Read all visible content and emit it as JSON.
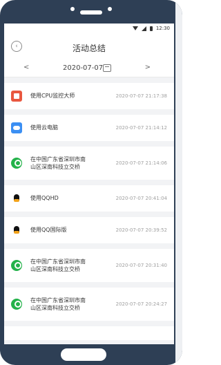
{
  "status": {
    "time": "12:30"
  },
  "header": {
    "title": "活动总结",
    "back_icon": "back-icon"
  },
  "date_nav": {
    "prev": "<",
    "date": "2020-07-07",
    "next": ">"
  },
  "items": [
    {
      "icon": "cpu-monitor-icon",
      "label": "使用CPU监控大师",
      "time": "2020-07-07 21:17:38"
    },
    {
      "icon": "cloud-computer-icon",
      "label": "使用云电脑",
      "time": "2020-07-07 21:14:12"
    },
    {
      "icon": "location-icon",
      "label": "在中国广东省深圳市南\n山区深南科技立交桥",
      "time": "2020-07-07 21:14:06"
    },
    {
      "icon": "qq-icon",
      "label": "使用QQHD",
      "time": "2020-07-07 20:41:04"
    },
    {
      "icon": "qq-icon",
      "label": "使用QQ国际版",
      "time": "2020-07-07 20:39:52"
    },
    {
      "icon": "location-icon",
      "label": "在中国广东省深圳市南\n山区深南科技立交桥",
      "time": "2020-07-07 20:31:40"
    },
    {
      "icon": "location-icon",
      "label": "在中国广东省深圳市南\n山区深南科技立交桥",
      "time": "2020-07-07 20:24:27"
    }
  ]
}
